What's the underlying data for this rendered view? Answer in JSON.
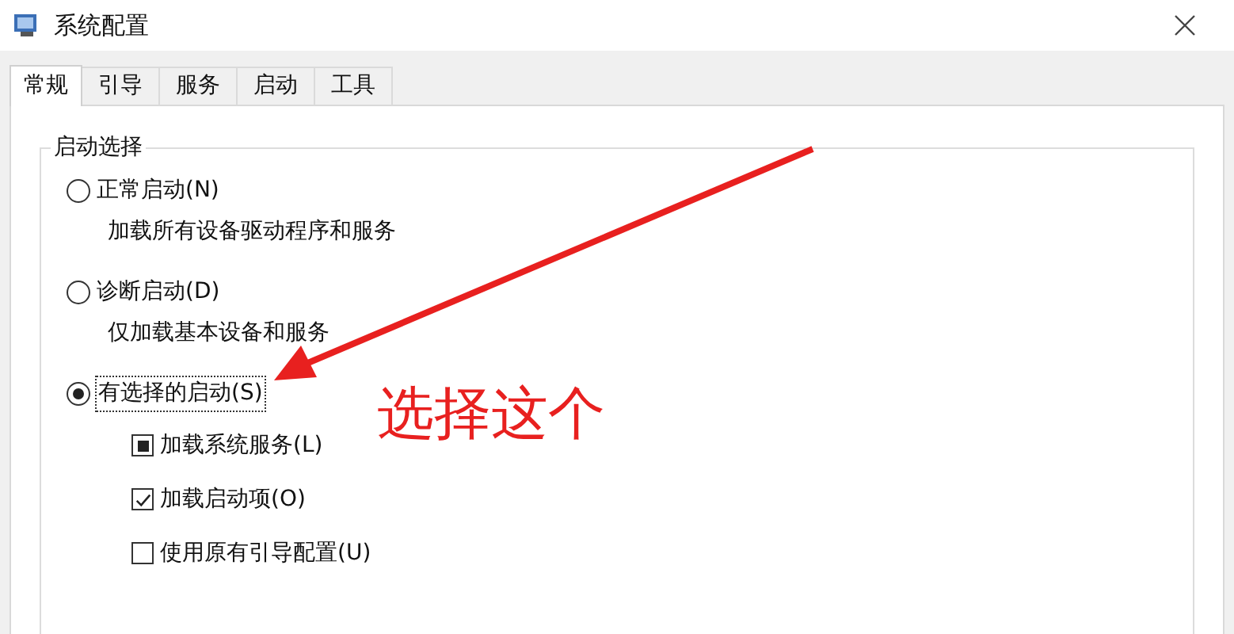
{
  "window": {
    "title": "系统配置"
  },
  "tabs": [
    {
      "label": "常规",
      "selected": true
    },
    {
      "label": "引导",
      "selected": false
    },
    {
      "label": "服务",
      "selected": false
    },
    {
      "label": "启动",
      "selected": false
    },
    {
      "label": "工具",
      "selected": false
    }
  ],
  "group": {
    "title": "启动选择",
    "options": [
      {
        "label": "正常启动(N)",
        "description": "加载所有设备驱动程序和服务",
        "selected": false
      },
      {
        "label": "诊断启动(D)",
        "description": "仅加载基本设备和服务",
        "selected": false
      },
      {
        "label": "有选择的启动(S)",
        "selected": true,
        "checkboxes": [
          {
            "label": "加载系统服务(L)",
            "checked": false,
            "mixed": true
          },
          {
            "label": "加载启动项(O)",
            "checked": true,
            "mixed": false
          },
          {
            "label": "使用原有引导配置(U)",
            "checked": false,
            "mixed": false
          }
        ]
      }
    ]
  },
  "annotation": {
    "text": "选择这个"
  }
}
